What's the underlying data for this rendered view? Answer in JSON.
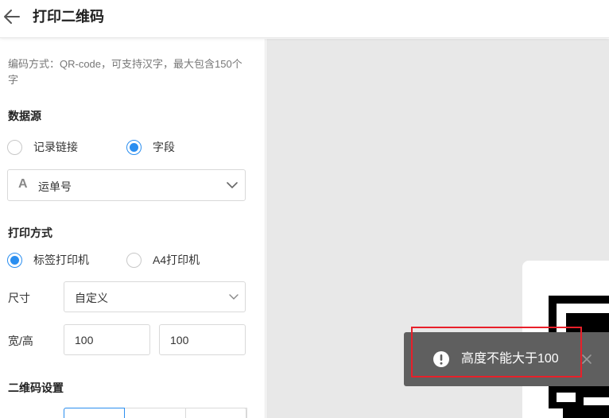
{
  "header": {
    "title": "打印二维码",
    "back_icon": "arrow-left-icon"
  },
  "panel": {
    "description": "编码方式：QR-code，可支持汉字，最大包含150个字",
    "data_source": {
      "label": "数据源",
      "options": [
        {
          "label": "记录链接",
          "selected": false
        },
        {
          "label": "字段",
          "selected": true
        }
      ],
      "field_select": {
        "type_icon": "text-type-icon",
        "type_glyph": "A",
        "value": "运单号"
      }
    },
    "print_method": {
      "label": "打印方式",
      "options": [
        {
          "label": "标签打印机",
          "selected": true
        },
        {
          "label": "A4打印机",
          "selected": false
        }
      ]
    },
    "size": {
      "label": "尺寸",
      "value": "自定义"
    },
    "width_height": {
      "label": "宽/高",
      "width": "100",
      "height": "100"
    },
    "qr_settings": {
      "label": "二维码设置"
    }
  },
  "toast": {
    "message": "高度不能大于100",
    "icon": "exclamation-circle-icon"
  },
  "colors": {
    "accent": "#2a8ef0",
    "toast_bg": "#5f5f5f",
    "canvas_bg": "#e8e8e8",
    "highlight": "#e8202a"
  }
}
